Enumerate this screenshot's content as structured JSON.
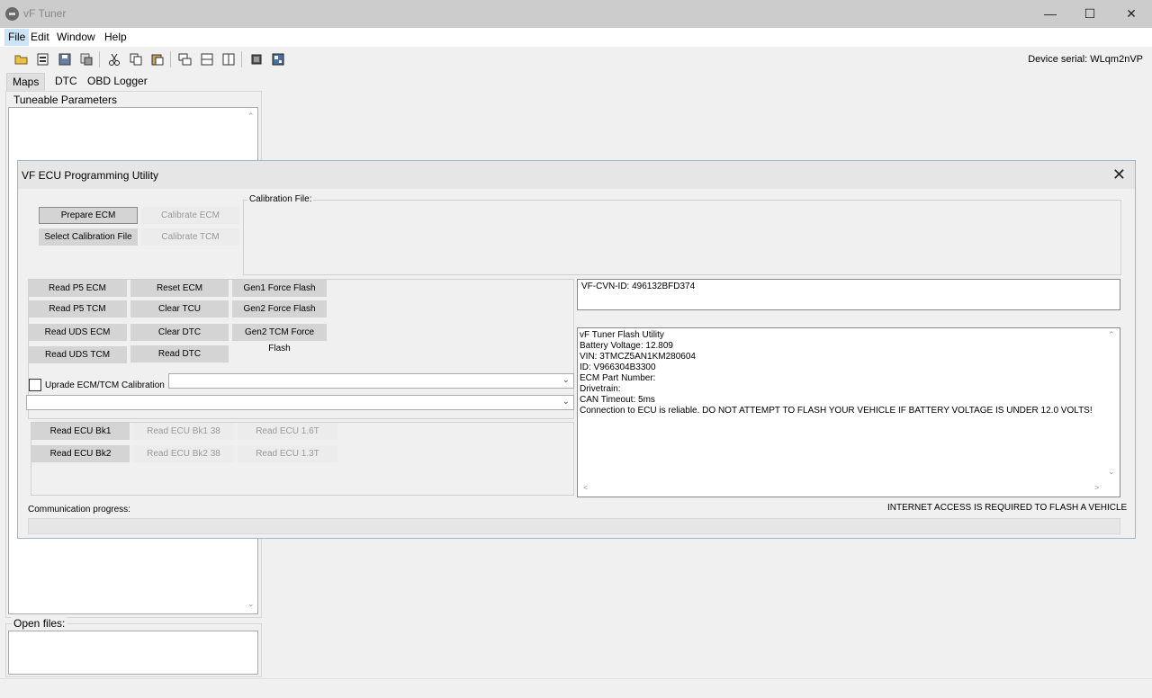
{
  "app": {
    "title": "vF Tuner"
  },
  "menu": {
    "file": "File",
    "edit": "Edit",
    "window": "Window",
    "help": "Help"
  },
  "toolbar": {
    "device_serial": "Device serial: WLqm2nVP"
  },
  "tabs": {
    "maps": "Maps",
    "dtc": "DTC",
    "obd_logger": "OBD Logger"
  },
  "left_panel": {
    "tuneable_label": "Tuneable Parameters",
    "open_files_label": "Open files:"
  },
  "dialog": {
    "title": "VF ECU Programming Utility",
    "prepare_ecm": "Prepare ECM",
    "calibrate_ecm": "Calibrate ECM",
    "select_calibration_file": "Select Calibration File",
    "calibrate_tcm": "Calibrate TCM",
    "calibration_file_label": "Calibration File:",
    "read_p5_ecm": "Read P5 ECM",
    "reset_ecm": "Reset ECM",
    "gen1_force_flash": "Gen1 Force Flash",
    "read_p5_tcm": "Read P5 TCM",
    "clear_tcu": "Clear TCU",
    "gen2_force_flash": "Gen2 Force Flash",
    "read_uds_ecm": "Read UDS ECM",
    "clear_dtc": "Clear DTC",
    "gen2_tcm_force_flash": "Gen2 TCM Force Flash",
    "read_uds_tcm": "Read UDS TCM",
    "read_dtc": "Read DTC",
    "upgrade_label": "Uprade ECM/TCM Calibration",
    "read_ecu_bk1": "Read ECU Bk1",
    "read_ecu_bk1_38": "Read ECU Bk1 38",
    "read_ecu_16t": "Read ECU 1.6T",
    "read_ecu_bk2": "Read ECU Bk2",
    "read_ecu_bk2_38": "Read ECU Bk2 38",
    "read_ecu_13t": "Read ECU 1.3T",
    "cvn_id": "VF-CVN-ID: 496132BFD374",
    "log": {
      "line1": "vF Tuner Flash Utility",
      "line2": "Battery Voltage: 12.809",
      "line3": "VIN: 3TMCZ5AN1KM280604",
      "line4": "ID: V966304B3300",
      "line5": "ECM Part Number:",
      "line6": "Drivetrain:",
      "line7": "CAN Timeout: 5ms",
      "line8": "Connection to ECU is reliable. DO NOT ATTEMPT TO FLASH YOUR VEHICLE IF BATTERY VOLTAGE IS UNDER 12.0 VOLTS!"
    },
    "internet_notice": "INTERNET ACCESS IS REQUIRED TO FLASH A VEHICLE",
    "communication_progress_label": "Communication progress:",
    "communication_progress": 0
  }
}
